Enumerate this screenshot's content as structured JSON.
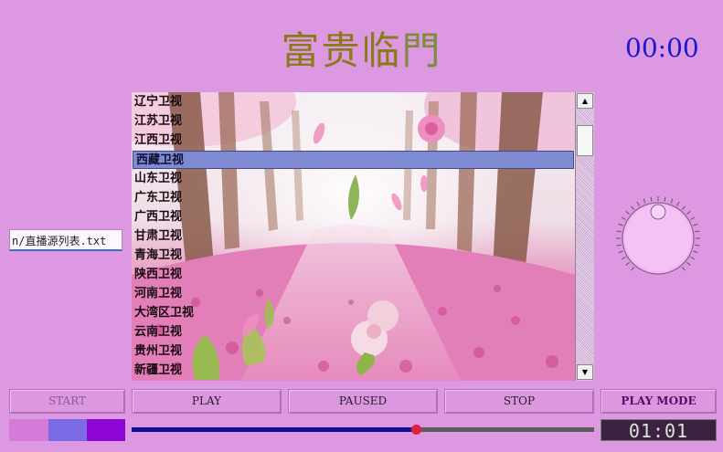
{
  "header": {
    "title_main": "富贵临",
    "title_tail": "門",
    "clock": "00:00"
  },
  "source_path": "n/直播源列表.txt",
  "playlist": {
    "channels": [
      "辽宁卫视",
      "江苏卫视",
      "江西卫视",
      "西藏卫视",
      "山东卫视",
      "广东卫视",
      "广西卫视",
      "甘肃卫视",
      "青海卫视",
      "陕西卫视",
      "河南卫视",
      "大湾区卫视",
      "云南卫视",
      "贵州卫视",
      "新疆卫视"
    ],
    "selected_index": 3
  },
  "scrollbar": {
    "up_glyph": "▲",
    "down_glyph": "▼"
  },
  "controls": {
    "start": "START",
    "play": "PLAY",
    "paused": "PAUSED",
    "stop": "STOP",
    "play_mode": "PLAY MODE"
  },
  "color_swatches": [
    "#d57ad8",
    "#7b6ae6",
    "#8e06d6"
  ],
  "progress": {
    "fraction": 0.615
  },
  "elapsed_time": "01:01",
  "colors": {
    "background": "#dc98e0",
    "selection": "#7e8ad2",
    "progress_fill": "#101090",
    "progress_handle": "#e02040"
  }
}
